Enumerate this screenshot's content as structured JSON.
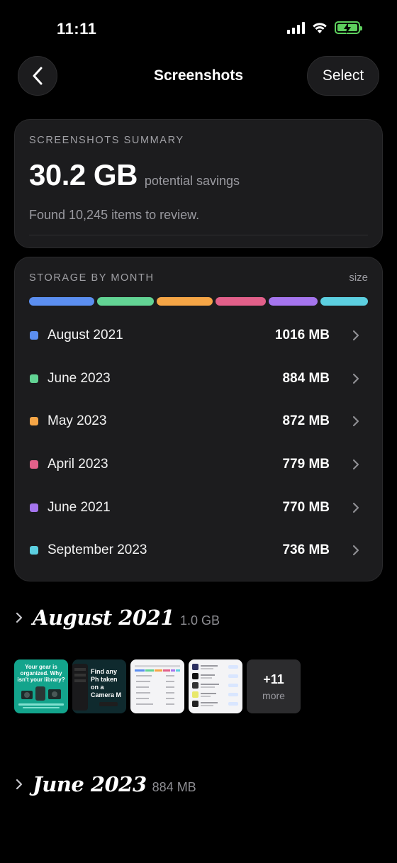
{
  "status_bar": {
    "time": "11:11"
  },
  "nav": {
    "title": "Screenshots",
    "select_label": "Select"
  },
  "summary": {
    "eyebrow": "SCREENSHOTS SUMMARY",
    "value": "30.2 GB",
    "value_label": "potential savings",
    "found_text": "Found 10,245 items to review."
  },
  "storage": {
    "eyebrow": "STORAGE BY MONTH",
    "size_label": "size",
    "months": [
      {
        "name": "August 2021",
        "size": "1016 MB",
        "color": "#5b8ef0",
        "mb": 1016
      },
      {
        "name": "June 2023",
        "size": "884 MB",
        "color": "#62d394",
        "mb": 884
      },
      {
        "name": "May 2023",
        "size": "872 MB",
        "color": "#f5a546",
        "mb": 872
      },
      {
        "name": "April 2023",
        "size": "779 MB",
        "color": "#e2608a",
        "mb": 779
      },
      {
        "name": "June 2021",
        "size": "770 MB",
        "color": "#a575ee",
        "mb": 770
      },
      {
        "name": "September 2023",
        "size": "736 MB",
        "color": "#5ccfe0",
        "mb": 736
      }
    ]
  },
  "sections": [
    {
      "title": "August 2021",
      "size": "1.0 GB",
      "thumb_texts": [
        "Your gear is organized. Why isn't your library?",
        "Find any Ph taken on a Camera M"
      ],
      "more_count": "+11",
      "more_label": "more"
    },
    {
      "title": "June 2023",
      "size": "884 MB"
    }
  ]
}
